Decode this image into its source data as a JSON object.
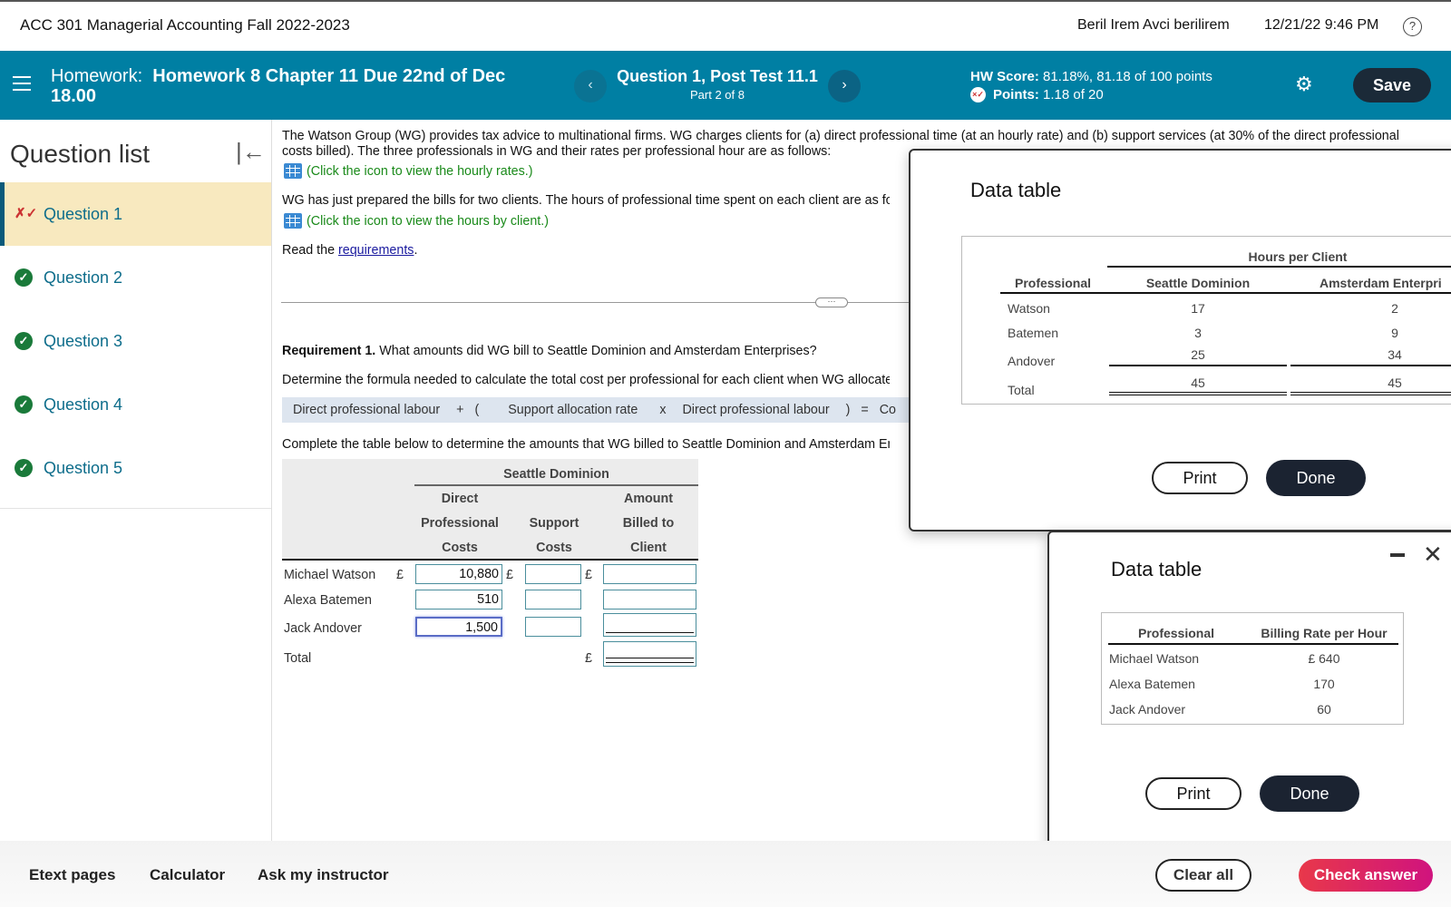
{
  "topbar": {
    "course_title": "ACC 301 Managerial Accounting Fall 2022-2023",
    "user_name": "Beril Irem Avci berilirem",
    "datetime": "12/21/22 9:46 PM",
    "help_icon": "?"
  },
  "header": {
    "homework_label": "Homework:",
    "homework_name": "Homework 8 Chapter 11 Due 22nd of Dec 18.00",
    "prev_icon": "‹",
    "next_icon": "›",
    "question_title": "Question 1, Post Test 11.1",
    "question_part": "Part 2 of 8",
    "hw_score_label": "HW Score:",
    "hw_score_value": "81.18%, 81.18 of 100 points",
    "points_label": "Points:",
    "points_value": "1.18 of 20",
    "points_icon": "×✓",
    "gear_icon": "⚙",
    "save_label": "Save"
  },
  "sidebar": {
    "title": "Question list",
    "collapse_icon": "|←",
    "items": [
      {
        "label": "Question 1",
        "status": "partial",
        "icon": "✗✓",
        "active": true
      },
      {
        "label": "Question 2",
        "status": "correct",
        "icon": "✓",
        "active": false
      },
      {
        "label": "Question 3",
        "status": "correct",
        "icon": "✓",
        "active": false
      },
      {
        "label": "Question 4",
        "status": "correct",
        "icon": "✓",
        "active": false
      },
      {
        "label": "Question 5",
        "status": "correct",
        "icon": "✓",
        "active": false
      }
    ]
  },
  "question": {
    "intro": "The Watson Group (WG) provides tax advice to multinational firms. WG charges clients for (a) direct professional time (at an hourly rate) and (b) support services (at 30% of the direct professional",
    "intro2": "costs billed). The three professionals in WG and their rates per professional hour are as follows:",
    "rates_link": "(Click the icon to view the hourly rates.)",
    "bills_text": "WG has just prepared the bills for two clients. The hours of professional time spent on each client are as fol",
    "hours_link": "(Click the icon to view the hours by client.)",
    "read_prefix": "Read the ",
    "requirements_link": "requirements",
    "read_suffix": ".",
    "divider_handle": "⋯",
    "req1_bold": "Requirement 1.",
    "req1_text": " What amounts did WG bill to Seattle Dominion and Amsterdam Enterprises?",
    "formula_intro": "Determine the formula needed to calculate the total cost per professional for each client when WG allocates",
    "formula": {
      "term1": "Direct professional labour",
      "op1": "+",
      "paren_open": "(",
      "term2": "Support allocation rate",
      "op2": "x",
      "term3": "Direct professional labour",
      "paren_close": ")",
      "eq": "=",
      "result": "Co"
    },
    "complete_text": "Complete the table below to determine the amounts that WG billed to Seattle Dominion and Amsterdam En"
  },
  "answer_table": {
    "client": "Seattle Dominion",
    "columns": [
      {
        "line1": "Direct",
        "line2": "Professional",
        "line3": "Costs"
      },
      {
        "line1": "",
        "line2": "Support",
        "line3": "Costs"
      },
      {
        "line1": "Amount",
        "line2": "Billed to",
        "line3": "Client"
      }
    ],
    "currency": "£",
    "rows": [
      {
        "label": "Michael Watson",
        "direct": "10,880",
        "support": "",
        "billed": ""
      },
      {
        "label": "Alexa Batemen",
        "direct": "510",
        "support": "",
        "billed": ""
      },
      {
        "label": "Jack Andover",
        "direct": "1,500",
        "support": "",
        "billed": ""
      }
    ],
    "total_label": "Total",
    "total_billed": ""
  },
  "hours_dialog": {
    "title": "Data table",
    "group_header": "Hours per Client",
    "col_professional": "Professional",
    "col_client1": "Seattle Dominion",
    "col_client2": "Amsterdam Enterpri",
    "rows": [
      {
        "name": "Watson",
        "seattle": "17",
        "amsterdam": "2"
      },
      {
        "name": "Batemen",
        "seattle": "3",
        "amsterdam": "9"
      },
      {
        "name": "Andover",
        "seattle": "25",
        "amsterdam": "34"
      }
    ],
    "total_label": "Total",
    "total_seattle": "45",
    "total_amsterdam": "45",
    "print_label": "Print",
    "done_label": "Done"
  },
  "rates_dialog": {
    "title": "Data table",
    "col_professional": "Professional",
    "col_rate": "Billing Rate per Hour",
    "rows": [
      {
        "name": "Michael Watson",
        "rate": "£ 640"
      },
      {
        "name": "Alexa Batemen",
        "rate": "170"
      },
      {
        "name": "Jack Andover",
        "rate": "60"
      }
    ],
    "print_label": "Print",
    "done_label": "Done",
    "close_icon": "✕"
  },
  "footer": {
    "etext": "Etext pages",
    "calculator": "Calculator",
    "ask": "Ask my instructor",
    "clear_all": "Clear all",
    "check_answer": "Check answer"
  }
}
